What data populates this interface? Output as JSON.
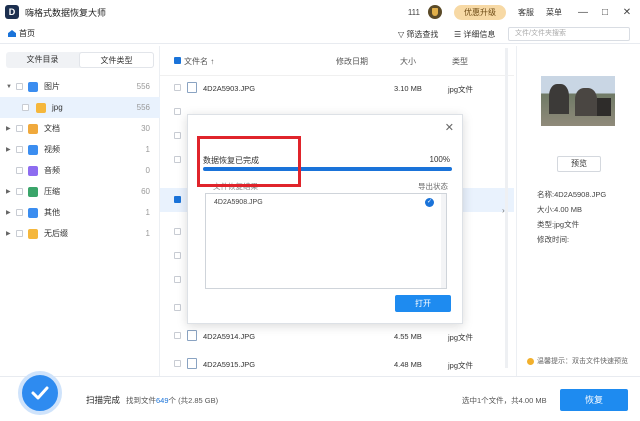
{
  "app": {
    "title": "嗨格式数据恢复大师",
    "count": "111",
    "upgrade": "优惠升级",
    "service": "客服",
    "menu": "菜单"
  },
  "toolbar": {
    "home": "首页",
    "filter": "筛选查找",
    "detail": "详细信息",
    "search_placeholder": "文件/文件夹搜索"
  },
  "left": {
    "tab_dir": "文件目录",
    "tab_type": "文件类型",
    "items": [
      {
        "label": "图片",
        "count": "556"
      },
      {
        "label": "jpg",
        "count": "556"
      },
      {
        "label": "文档",
        "count": "30"
      },
      {
        "label": "视频",
        "count": "1"
      },
      {
        "label": "音频",
        "count": "0"
      },
      {
        "label": "压缩",
        "count": "60"
      },
      {
        "label": "其他",
        "count": "1"
      },
      {
        "label": "无后缀",
        "count": "1"
      }
    ]
  },
  "table": {
    "col_name": "文件名 ↑",
    "col_date": "修改日期",
    "col_size": "大小",
    "col_type": "类型",
    "rows": [
      {
        "name": "4D2A5903.JPG",
        "size": "3.10 MB",
        "type": "jpg文件"
      },
      {
        "name": "4D2A5914.JPG",
        "size": "4.55 MB",
        "type": "jpg文件"
      },
      {
        "name": "4D2A5915.JPG",
        "size": "4.48 MB",
        "type": "jpg文件"
      }
    ]
  },
  "detail": {
    "preview": "预览",
    "name": "名称:4D2A5908.JPG",
    "size": "大小:4.00 MB",
    "type": "类型:jpg文件",
    "modified": "修改时间:",
    "tip": "温馨提示：双击文件快速预览"
  },
  "bottom": {
    "scan_done": "扫描完成",
    "found_prefix": "找到文件",
    "found_count": "649",
    "found_suffix": "个 (共2.85 GB)",
    "selected": "选中1个文件，共4.00 MB",
    "recover": "恢复"
  },
  "dialog": {
    "status": "数据恢复已完成",
    "percent": "100%",
    "progress": 1.0,
    "list_label": "文件恢复结果",
    "export": "导出状态",
    "file": "4D2A5908.JPG",
    "open": "打开"
  }
}
